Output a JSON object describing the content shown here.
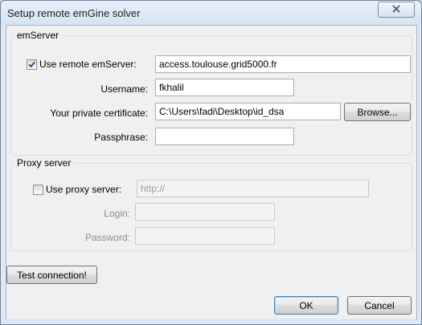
{
  "window": {
    "title": "Setup remote emGine solver"
  },
  "emserver": {
    "group_label": "emServer",
    "use_remote_label": "Use remote emServer:",
    "use_remote_checked": true,
    "server_value": "access.toulouse.grid5000.fr",
    "username_label": "Username:",
    "username_value": "fkhalil",
    "cert_label": "Your private certificate:",
    "cert_value": "C:\\Users\\fadi\\Desktop\\id_dsa",
    "browse_label": "Browse...",
    "passphrase_label": "Passphrase:",
    "passphrase_value": ""
  },
  "proxy": {
    "group_label": "Proxy server",
    "use_proxy_label": "Use proxy server:",
    "use_proxy_checked": false,
    "url_value": "http://",
    "login_label": "Login:",
    "login_value": "",
    "password_label": "Password:",
    "password_value": ""
  },
  "buttons": {
    "test_label": "Test connection!",
    "ok_label": "OK",
    "cancel_label": "Cancel"
  },
  "icons": {
    "close": "close-icon",
    "check": "checkmark-icon"
  }
}
